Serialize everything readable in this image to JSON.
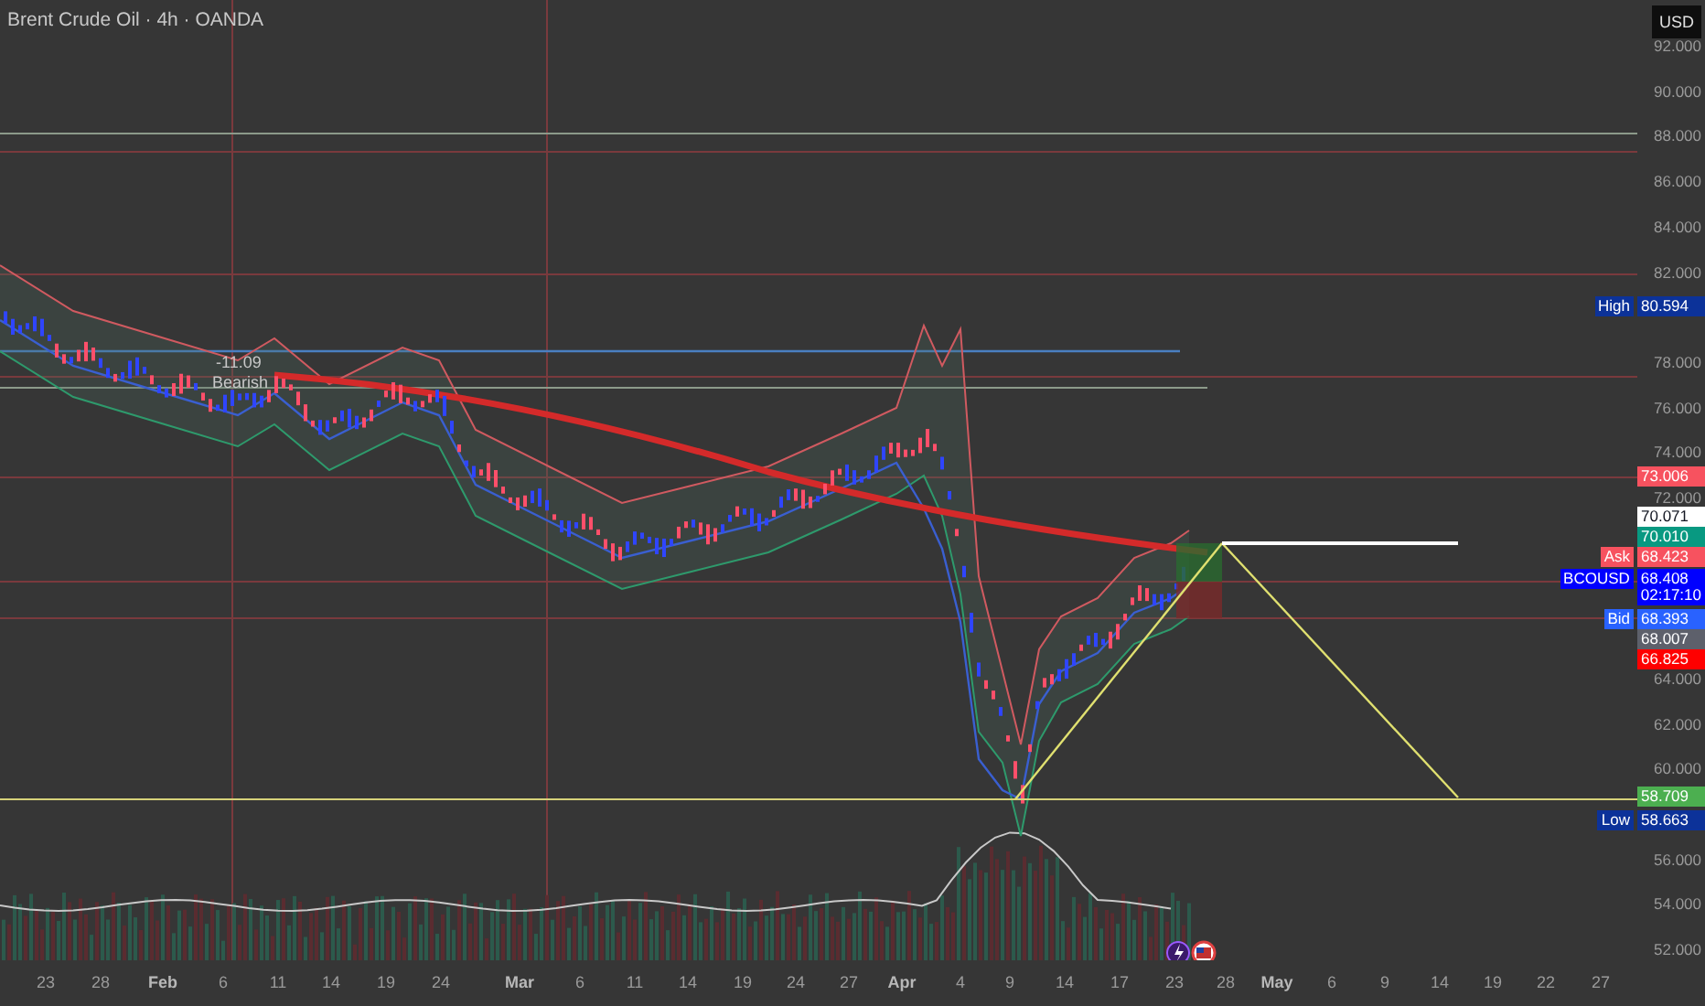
{
  "title": "Brent Crude Oil · 4h · OANDA",
  "currency": "USD",
  "annotations": [
    {
      "text": "-11.09"
    },
    {
      "text": "Bearish"
    }
  ],
  "price_axis": {
    "ticks": [
      "92.000",
      "90.000",
      "88.000",
      "86.000",
      "84.000",
      "82.000",
      "78.000",
      "76.000",
      "74.000",
      "72.000",
      "64.000",
      "62.000",
      "60.000",
      "56.000",
      "54.000",
      "52.000"
    ]
  },
  "price_tags": [
    {
      "label": "High",
      "value": "80.594",
      "color": "#0c3299"
    },
    {
      "value": "73.006",
      "color": "#f7525f"
    },
    {
      "value": "70.071",
      "color": "#ffffff"
    },
    {
      "value": "70.010",
      "color": "#089981"
    },
    {
      "label": "Ask",
      "value": "68.423",
      "color": "#f7525f"
    },
    {
      "label": "BCOUSD",
      "value": "68.408",
      "countdown": "02:17:10",
      "color": "#0000ff"
    },
    {
      "label": "Bid",
      "value": "68.393",
      "color": "#2962ff"
    },
    {
      "value": "68.007",
      "color": "#5d606b"
    },
    {
      "value": "66.825",
      "color": "#ff0000"
    },
    {
      "value": "58.709",
      "color": "#4caf50"
    },
    {
      "label": "Low",
      "value": "58.663",
      "color": "#0c3299"
    }
  ],
  "time_axis": [
    {
      "text": "23",
      "month": false
    },
    {
      "text": "28",
      "month": false
    },
    {
      "text": "Feb",
      "month": true
    },
    {
      "text": "6",
      "month": false
    },
    {
      "text": "11",
      "month": false
    },
    {
      "text": "14",
      "month": false
    },
    {
      "text": "19",
      "month": false
    },
    {
      "text": "24",
      "month": false
    },
    {
      "text": "Mar",
      "month": true
    },
    {
      "text": "6",
      "month": false
    },
    {
      "text": "11",
      "month": false
    },
    {
      "text": "14",
      "month": false
    },
    {
      "text": "19",
      "month": false
    },
    {
      "text": "24",
      "month": false
    },
    {
      "text": "27",
      "month": false
    },
    {
      "text": "Apr",
      "month": true
    },
    {
      "text": "4",
      "month": false
    },
    {
      "text": "9",
      "month": false
    },
    {
      "text": "14",
      "month": false
    },
    {
      "text": "17",
      "month": false
    },
    {
      "text": "23",
      "month": false
    },
    {
      "text": "28",
      "month": false
    },
    {
      "text": "May",
      "month": true
    },
    {
      "text": "6",
      "month": false
    },
    {
      "text": "9",
      "month": false
    },
    {
      "text": "14",
      "month": false
    },
    {
      "text": "19",
      "month": false
    },
    {
      "text": "22",
      "month": false
    },
    {
      "text": "27",
      "month": false
    }
  ]
}
